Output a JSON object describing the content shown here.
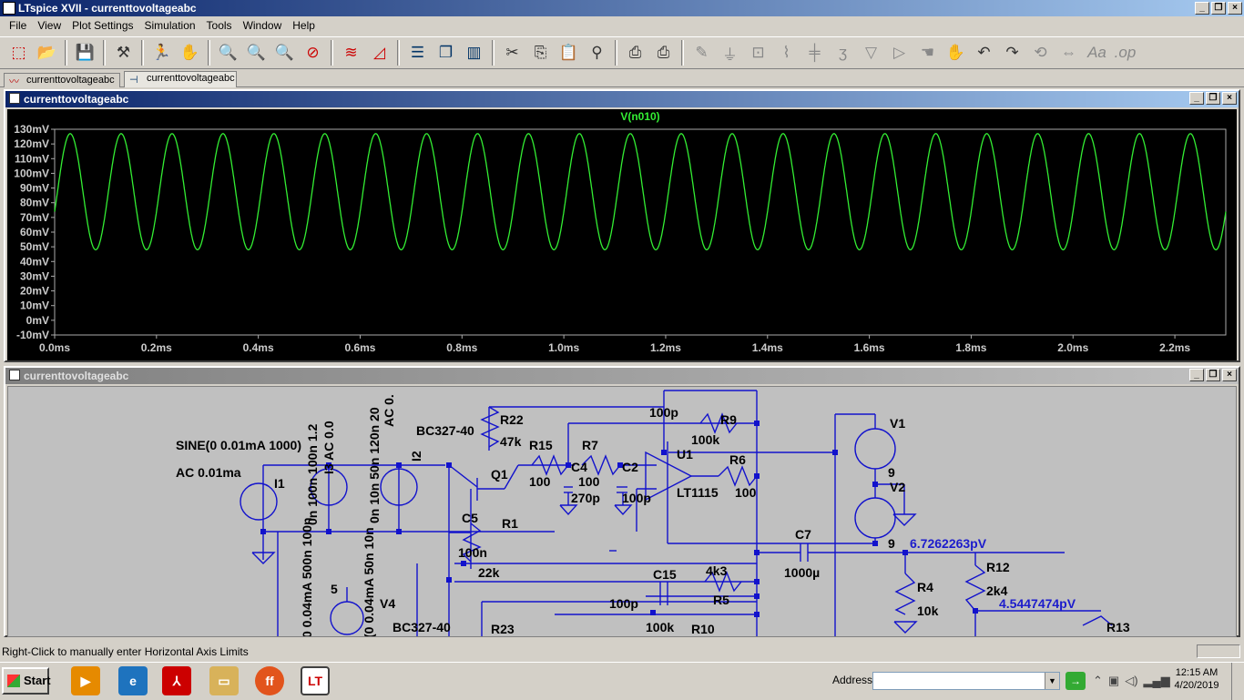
{
  "window": {
    "title": "LTspice XVII - currenttovoltageabc"
  },
  "menu": [
    "File",
    "View",
    "Plot Settings",
    "Simulation",
    "Tools",
    "Window",
    "Help"
  ],
  "toolbar_icons": [
    "new-schematic-icon",
    "open-icon",
    "save-icon",
    "control-panel-icon",
    "run-icon",
    "halt-icon",
    "zoom-in-icon",
    "zoom-pan-icon",
    "zoom-out-icon",
    "zoom-cancel-icon",
    "autorange-icon",
    "plot-settings-icon",
    "tile-horizontal-icon",
    "cascade-icon",
    "tile-vertical-icon",
    "cut-icon",
    "copy-icon",
    "paste-icon",
    "find-icon",
    "print-setup-icon",
    "print-icon",
    "wire-icon",
    "ground-icon",
    "label-icon",
    "resistor-icon",
    "capacitor-icon",
    "inductor-icon",
    "diode-icon",
    "component-icon",
    "move-icon",
    "drag-icon",
    "undo-icon",
    "redo-icon",
    "rotate-icon",
    "mirror-icon",
    "text-icon",
    "spice-directive-icon"
  ],
  "tabs": [
    "currenttovoltageabc",
    "currenttovoltageabc"
  ],
  "plot_window": {
    "title": "currenttovoltageabc",
    "trace_label": "V(n010)",
    "trace_color": "#33ee33"
  },
  "schematic_window": {
    "title": "currenttovoltageabc"
  },
  "chart_data": {
    "type": "line",
    "title": "",
    "xlabel": "",
    "ylabel": "",
    "x_ticks": [
      "0.0ms",
      "0.2ms",
      "0.4ms",
      "0.6ms",
      "0.8ms",
      "1.0ms",
      "1.2ms",
      "1.4ms",
      "1.6ms",
      "1.8ms",
      "2.0ms",
      "2.2ms"
    ],
    "y_ticks": [
      "130mV",
      "120mV",
      "110mV",
      "100mV",
      "90mV",
      "80mV",
      "70mV",
      "60mV",
      "50mV",
      "40mV",
      "30mV",
      "20mV",
      "10mV",
      "0mV",
      "-10mV"
    ],
    "xlim": [
      0,
      2.3
    ],
    "ylim": [
      -10,
      130
    ],
    "series": [
      {
        "name": "V(n010)",
        "waveform": "sine",
        "offset_mV": 87.5,
        "amplitude_mV": 39.5,
        "frequency_kHz": 10,
        "color": "#33ee33"
      }
    ]
  },
  "schematic_labels": [
    {
      "text": "R22"
    },
    {
      "text": "47k"
    },
    {
      "text": "BC327-40"
    },
    {
      "text": "R15"
    },
    {
      "text": "R7"
    },
    {
      "text": "100p"
    },
    {
      "text": "R9"
    },
    {
      "text": "100k"
    },
    {
      "text": "U1"
    },
    {
      "text": "V1"
    },
    {
      "text": "SINE(0 0.01mA 1000)"
    },
    {
      "text": "AC 0.01ma"
    },
    {
      "text": "I1"
    },
    {
      "text": "Q1"
    },
    {
      "text": "100"
    },
    {
      "text": "C4"
    },
    {
      "text": "100"
    },
    {
      "text": "C2"
    },
    {
      "text": "R6"
    },
    {
      "text": "270p"
    },
    {
      "text": "100p"
    },
    {
      "text": "LT1115"
    },
    {
      "text": "100"
    },
    {
      "text": "9"
    },
    {
      "text": "V2"
    },
    {
      "text": "C5"
    },
    {
      "text": "R1"
    },
    {
      "text": "C7"
    },
    {
      "text": "9"
    },
    {
      "text": "6.7262263pV"
    },
    {
      "text": "100n"
    },
    {
      "text": "R12"
    },
    {
      "text": "22k"
    },
    {
      "text": "1000µ"
    },
    {
      "text": "C15"
    },
    {
      "text": "4k3"
    },
    {
      "text": "R4"
    },
    {
      "text": "2k4"
    },
    {
      "text": "5"
    },
    {
      "text": "100p"
    },
    {
      "text": "R5"
    },
    {
      "text": "10k"
    },
    {
      "text": "V4"
    },
    {
      "text": "4.5447474pV"
    },
    {
      "text": "100k"
    },
    {
      "text": "R10"
    },
    {
      "text": "BC327-40"
    },
    {
      "text": "R23"
    },
    {
      "text": "R13"
    },
    {
      "text": "I3  AC 0.0"
    },
    {
      "text": "I2"
    },
    {
      "text": "AC 0."
    },
    {
      "text": "0n 100n 100n 1.2"
    },
    {
      "text": "0n 10n 50n 120n 20"
    },
    {
      "text": "0 0.04mA 500n 100n"
    },
    {
      "text": "(0 0.04mA 50n 10n"
    }
  ],
  "statusbar": {
    "text": "Right-Click to manually enter Horizontal Axis Limits"
  },
  "taskbar": {
    "start_label": "Start",
    "apps": [
      "media-player-icon",
      "ie-icon",
      "pdf-icon",
      "explorer-icon",
      "firefox-icon",
      "ltspice-icon"
    ],
    "address_label": "Address",
    "address_value": "",
    "clock_time": "12:15 AM",
    "clock_date": "4/20/2019"
  }
}
